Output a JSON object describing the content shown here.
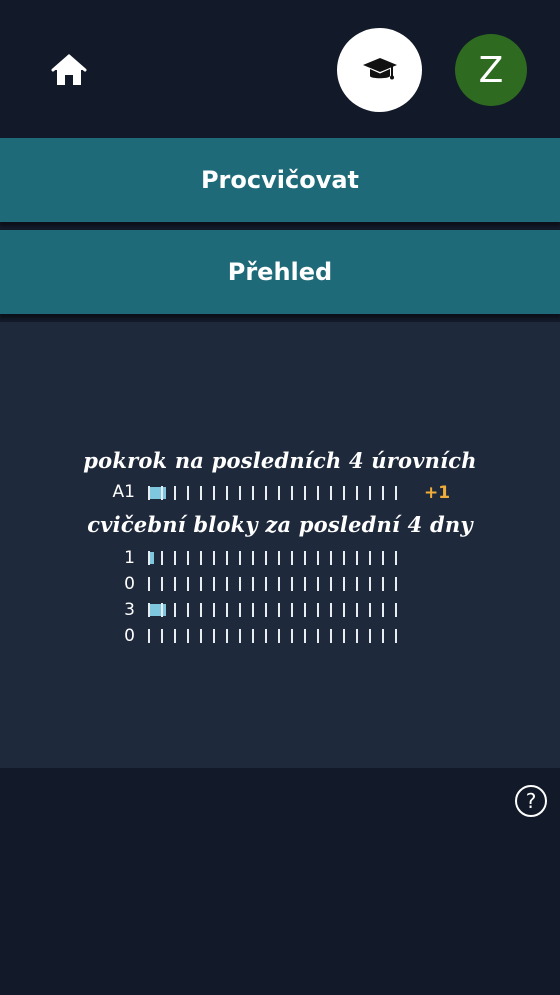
{
  "header": {
    "home_icon": "home-icon",
    "practice_icon": "graduation-cap-icon",
    "avatar_letter": "Z"
  },
  "nav": {
    "practice_label": "Procvičovat",
    "overview_label": "Přehled"
  },
  "progress": {
    "level_heading": "pokrok na posledních 4 úrovních",
    "levels": [
      {
        "label": "A1",
        "filled": 2,
        "delta": "+1"
      }
    ],
    "blocks_heading": "cvičební bloky za poslední 4 dny",
    "days": [
      {
        "label": "1",
        "filled": 1
      },
      {
        "label": "0",
        "filled": 0
      },
      {
        "label": "3",
        "filled": 2
      },
      {
        "label": "0",
        "filled": 0
      }
    ],
    "segments_per_bar": 20
  },
  "footer": {
    "help_symbol": "?"
  },
  "colors": {
    "background": "#121a29",
    "panel": "#1e293b",
    "nav_button": "#1e6a78",
    "avatar": "#2e6a20",
    "fill": "#7fc7de",
    "delta": "#f0ad3a"
  }
}
